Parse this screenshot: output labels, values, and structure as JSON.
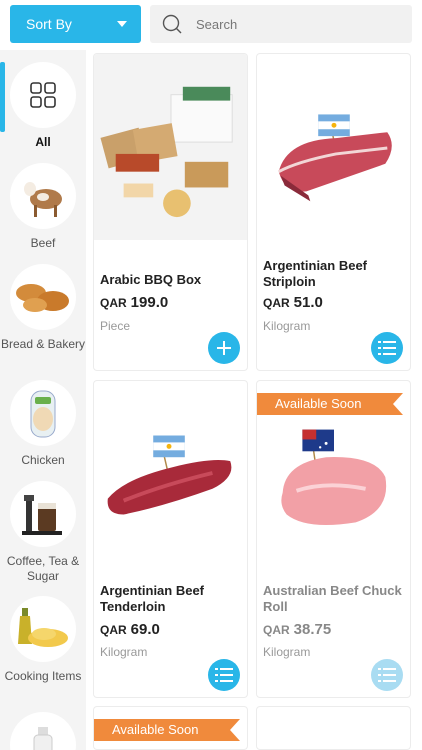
{
  "header": {
    "sort_label": "Sort By",
    "search_placeholder": "Search"
  },
  "sidebar": {
    "items": [
      {
        "label": "All",
        "icon": "grid-icon",
        "active": true
      },
      {
        "label": "Beef",
        "icon": "cow-icon"
      },
      {
        "label": "Bread & Bakery",
        "icon": "bread-icon"
      },
      {
        "label": "Chicken",
        "icon": "chicken-icon"
      },
      {
        "label": "Coffee, Tea & Sugar",
        "icon": "coffee-icon"
      },
      {
        "label": "Cooking Items",
        "icon": "oil-pasta-icon"
      }
    ]
  },
  "products": [
    {
      "name": "Arabic BBQ Box",
      "currency": "QAR",
      "price": "199.0",
      "unit": "Piece",
      "action": "add"
    },
    {
      "name": "Argentinian Beef Striploin",
      "currency": "QAR",
      "price": "51.0",
      "unit": "Kilogram",
      "action": "options"
    },
    {
      "name": "Argentinian Beef Tenderloin",
      "currency": "QAR",
      "price": "69.0",
      "unit": "Kilogram",
      "action": "options"
    },
    {
      "name": "Australian Beef Chuck Roll",
      "currency": "QAR",
      "price": "38.75",
      "unit": "Kilogram",
      "action": "options",
      "badge": "Available Soon"
    },
    {
      "badge": "Available Soon"
    }
  ],
  "colors": {
    "accent": "#29b6e8",
    "badge": "#f08a3c"
  }
}
